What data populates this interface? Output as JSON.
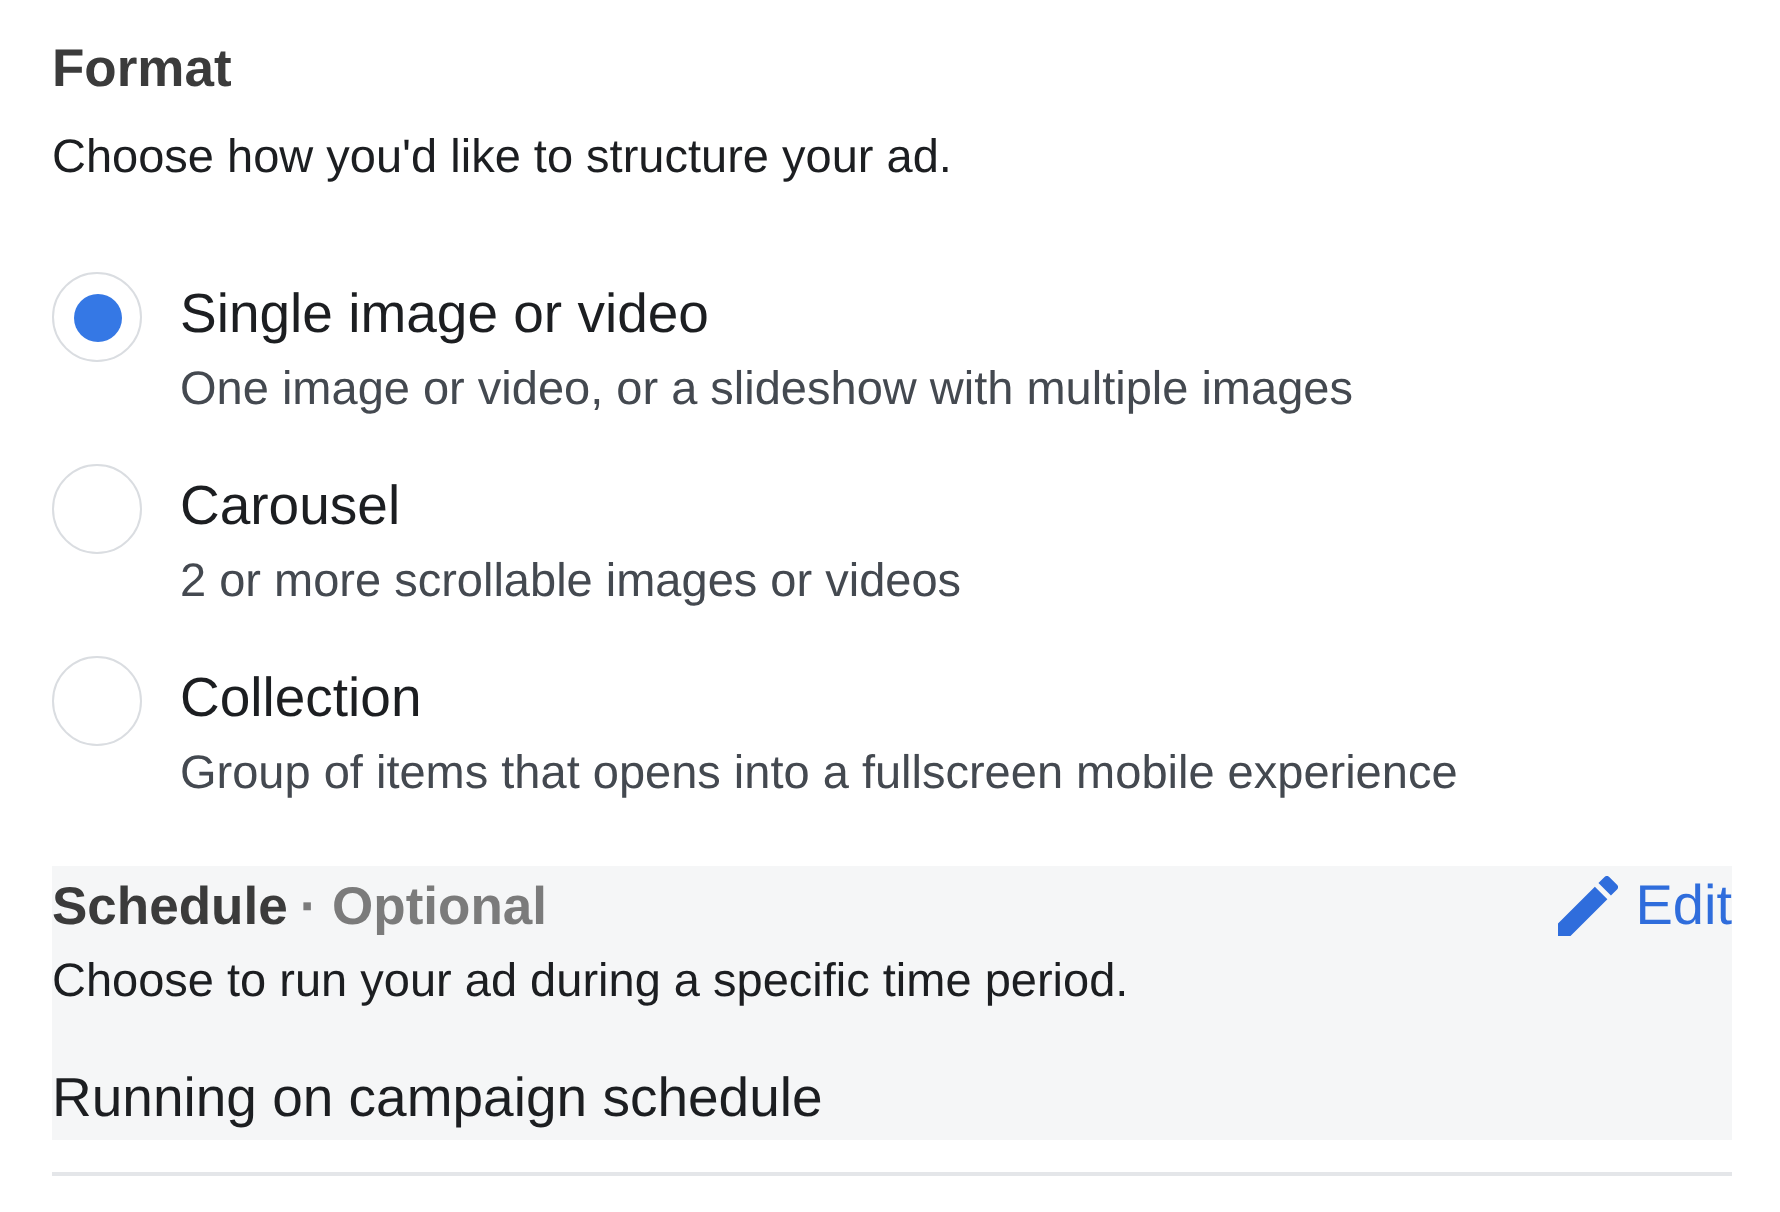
{
  "format": {
    "title": "Format",
    "subtitle": "Choose how you'd like to structure your ad.",
    "options": [
      {
        "label": "Single image or video",
        "description": "One image or video, or a slideshow with multiple images",
        "selected": true
      },
      {
        "label": "Carousel",
        "description": "2 or more scrollable images or videos",
        "selected": false
      },
      {
        "label": "Collection",
        "description": "Group of items that opens into a fullscreen mobile experience",
        "selected": false
      }
    ]
  },
  "schedule": {
    "title": "Schedule",
    "optional_label": "· Optional",
    "description": "Choose to run your ad during a specific time period.",
    "edit_button": "Edit",
    "value": "Running on campaign schedule"
  }
}
